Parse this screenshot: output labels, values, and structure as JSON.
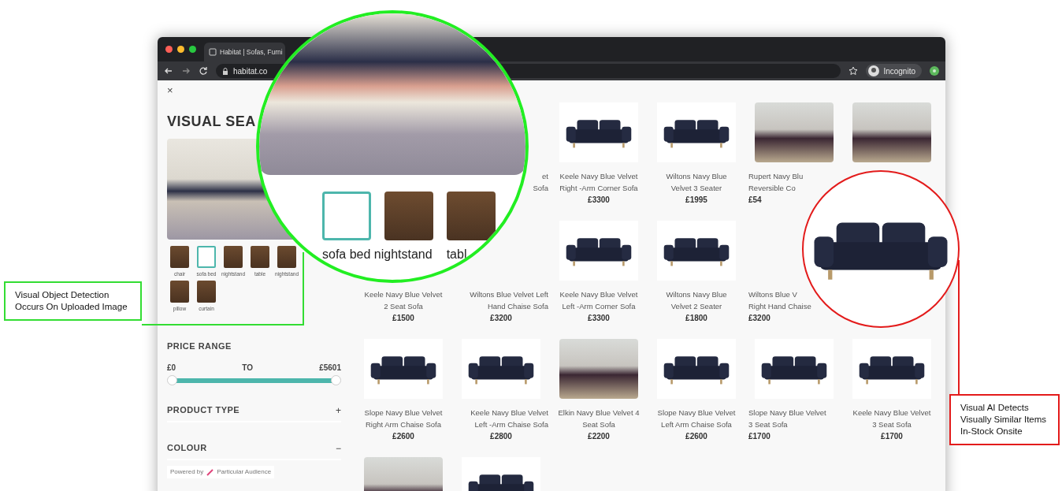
{
  "browser": {
    "tab_title": "Habitat | Sofas, Furni",
    "url": "habitat.co",
    "profile": "Incognito"
  },
  "panel": {
    "close": "×",
    "title": "VISUAL SEA",
    "objects": [
      {
        "label": "chair",
        "selected": false
      },
      {
        "label": "sofa bed",
        "selected": true
      },
      {
        "label": "nightstand",
        "selected": false
      },
      {
        "label": "table",
        "selected": false
      },
      {
        "label": "nightstand",
        "selected": false
      },
      {
        "label": "pillow",
        "selected": false
      },
      {
        "label": "curtain",
        "selected": false
      }
    ],
    "price_range": {
      "title": "PRICE RANGE",
      "min": "£0",
      "separator": "TO",
      "max": "£5601",
      "level": 1
    },
    "filters": [
      {
        "title": "PRODUCT TYPE",
        "toggle": "+"
      },
      {
        "title": "COLOUR",
        "toggle": "−"
      }
    ],
    "powered_by": "Powered by",
    "brand": "Particular Audience"
  },
  "products": [
    {
      "kind": "covered"
    },
    {
      "kind": "covered",
      "name": [
        "et",
        "Sofa"
      ]
    },
    {
      "kind": "cutout",
      "name": [
        "Keele Navy Blue Velvet",
        "Right -Arm Corner Sofa"
      ],
      "price": "£3300"
    },
    {
      "kind": "cutout",
      "name": [
        "Wiltons Navy Blue",
        "Velvet 3 Seater"
      ],
      "price": "£1995"
    },
    {
      "kind": "photo",
      "name": [
        "Rupert Navy Blu",
        "Reversible Co"
      ],
      "price": "£54"
    },
    {
      "kind": "photo"
    },
    {
      "kind": "covered",
      "name": [
        "Keele Navy Blue Velvet",
        "2 Seat Sofa"
      ],
      "price": "£1500"
    },
    {
      "kind": "covered",
      "name": [
        "Wiltons Blue Velvet Left",
        "Hand Chaise Sofa"
      ],
      "price": "£3200"
    },
    {
      "kind": "cutout",
      "name": [
        "Keele Navy Blue Velvet",
        "Left -Arm Corner Sofa"
      ],
      "price": "£3300"
    },
    {
      "kind": "cutout",
      "name": [
        "Wiltons Navy Blue",
        "Velvet 2 Seater"
      ],
      "price": "£1800"
    },
    {
      "kind": "covered",
      "name": [
        "Wiltons Blue V",
        "Right Hand Chaise"
      ],
      "price": "£3200"
    },
    {
      "kind": "covered"
    },
    {
      "kind": "cutout",
      "name": [
        "Slope Navy Blue Velvet",
        "Right Arm Chaise Sofa"
      ],
      "price": "£2600"
    },
    {
      "kind": "cutout",
      "name": [
        "Keele Navy Blue Velvet",
        "Left -Arm Chaise Sofa"
      ],
      "price": "£2800"
    },
    {
      "kind": "photo",
      "name": [
        "Elkin Navy Blue Velvet 4",
        "Seat Sofa"
      ],
      "price": "£2200"
    },
    {
      "kind": "cutout",
      "name": [
        "Slope Navy Blue Velvet",
        "Left Arm Chaise Sofa"
      ],
      "price": "£2600"
    },
    {
      "kind": "cutout",
      "name": [
        "Slope Navy Blue Velvet",
        "3 Seat Sofa"
      ],
      "price": "£1700"
    },
    {
      "kind": "cutout",
      "name": [
        "Keele Navy Blue Velvet",
        "3 Seat Sofa"
      ],
      "price": "£1700"
    },
    {
      "kind": "photo"
    },
    {
      "kind": "cutout"
    }
  ],
  "magnifier": {
    "thumbnails": [
      {
        "selected": true
      },
      {
        "selected": false
      },
      {
        "selected": false
      }
    ],
    "labels": [
      "sofa bed nightstand",
      "tabl"
    ]
  },
  "callouts": [
    {
      "text": "Visual Object Detection Occurs On Uploaded Image",
      "color": "#33dd33"
    },
    {
      "text": "Visual AI Detects Visually Similar Items In-Stock Onsite",
      "color": "#e31b1b"
    }
  ]
}
